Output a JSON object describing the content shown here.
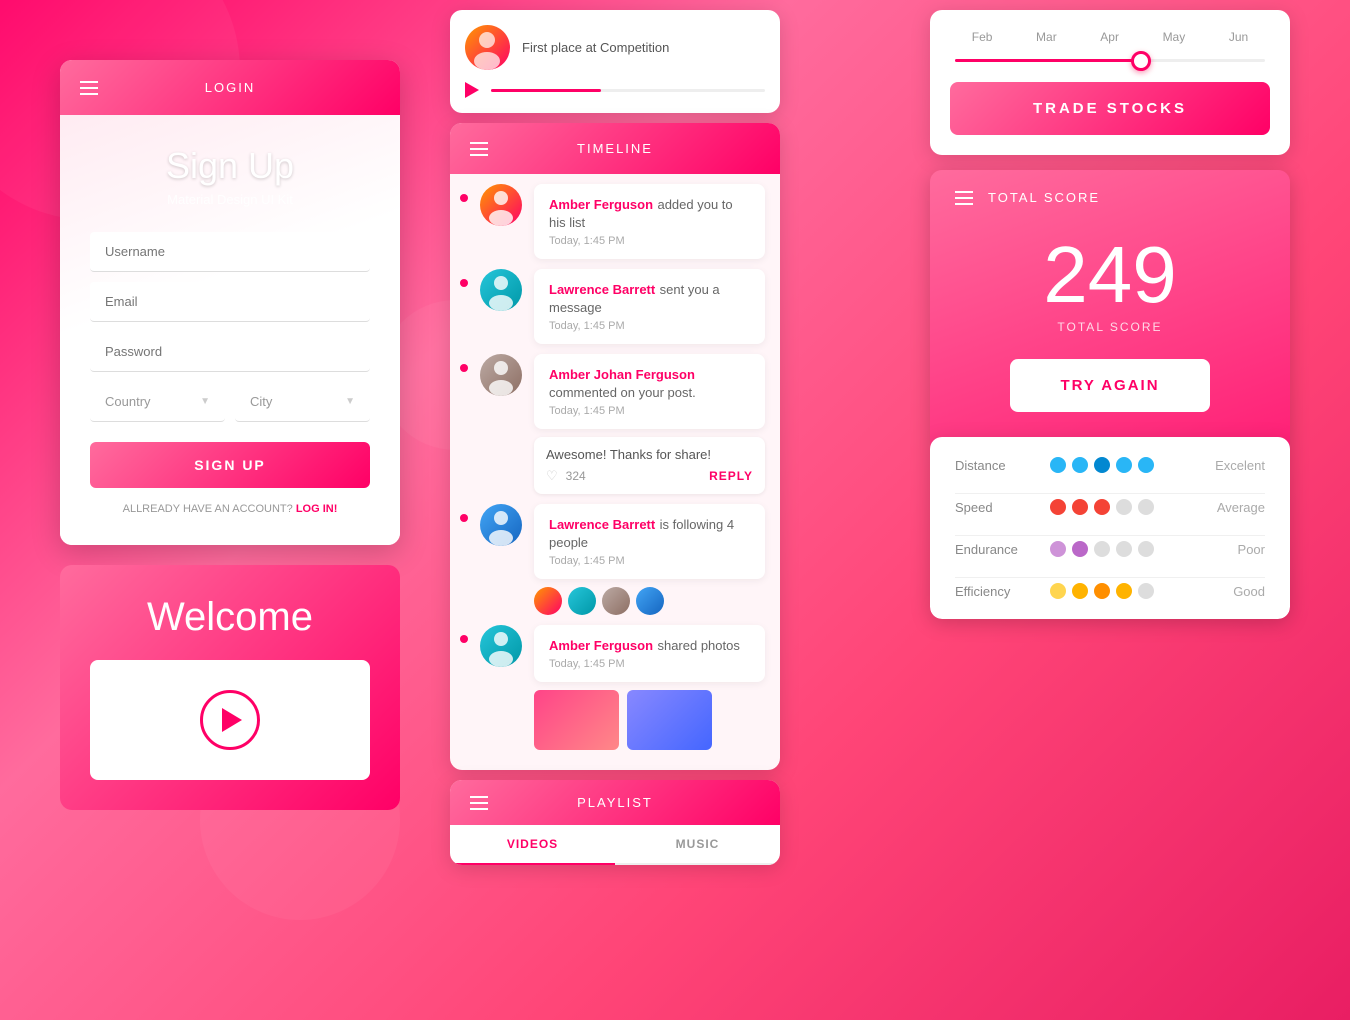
{
  "background": {
    "gradient": "linear-gradient(135deg, #f06, #ff6b9d, #ff4577, #e91e63)"
  },
  "login_card": {
    "header": {
      "title": "LOGIN"
    },
    "title": "Sign Up",
    "subtitle": "Material Design UI Kit",
    "fields": {
      "username": "Username",
      "email": "Email",
      "password": "Password",
      "country": "Country",
      "city": "City"
    },
    "signup_button": "SIGN UP",
    "login_prompt": "ALLREADY HAVE AN ACCOUNT?",
    "login_link": "LOG IN!"
  },
  "welcome_card": {
    "title": "Welcome"
  },
  "music_player": {
    "artist_info": "First place at Competition"
  },
  "timeline_card": {
    "title": "TIMELINE",
    "items": [
      {
        "name": "Amber Ferguson",
        "action": "added you to his list",
        "time": "Today, 1:45 PM"
      },
      {
        "name": "Lawrence Barrett",
        "action": "sent you a message",
        "time": "Today, 1:45 PM"
      },
      {
        "name": "Amber Johan Ferguson",
        "action": "commented on your post.",
        "time": "Today, 1:45 PM",
        "comment": "Awesome! Thanks for share!",
        "likes": "324",
        "reply": "REPLY"
      },
      {
        "name": "Lawrence Barrett",
        "action": "is following 4 people",
        "time": "Today, 1:45 PM"
      },
      {
        "name": "Amber Ferguson",
        "action": "shared photos",
        "time": "Today, 1:45 PM"
      }
    ]
  },
  "playlist_card": {
    "title": "PLAYLIST",
    "tabs": [
      "VIDEOS",
      "MUSIC"
    ]
  },
  "stock_card": {
    "months": [
      "Feb",
      "Mar",
      "Apr",
      "May",
      "Jun"
    ],
    "trade_button": "TRADE STOCKS"
  },
  "score_card": {
    "title": "TOTAL SCORE",
    "score": "249",
    "score_label": "TOTAL SCORE",
    "try_again_button": "TRY AGAIN",
    "stats": [
      {
        "label": "Distance",
        "dots": [
          "blue",
          "blue",
          "blue",
          "blue",
          "blue"
        ],
        "rating": "Excelent"
      },
      {
        "label": "Speed",
        "dots": [
          "red",
          "red",
          "red",
          "grey",
          "grey"
        ],
        "rating": "Average"
      },
      {
        "label": "Endurance",
        "dots": [
          "purple",
          "light-purple",
          "grey",
          "grey",
          "grey"
        ],
        "rating": "Poor"
      },
      {
        "label": "Efficiency",
        "dots": [
          "yellow",
          "amber",
          "orange",
          "amber",
          "grey"
        ],
        "rating": "Good"
      }
    ]
  }
}
